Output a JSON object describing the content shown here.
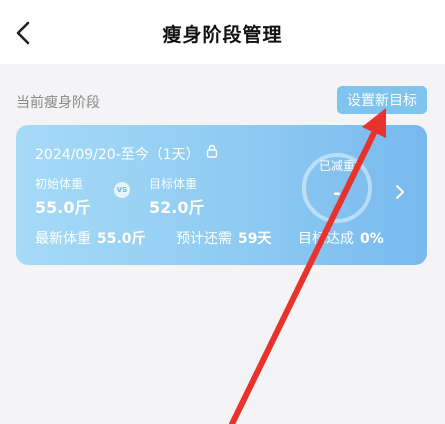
{
  "header": {
    "title": "瘦身阶段管理",
    "back_icon": "chevron-left-icon"
  },
  "section": {
    "label": "当前瘦身阶段",
    "set_goal_button": "设置新目标"
  },
  "stage_card": {
    "date_range": "2024/09/20-至今（1天）",
    "lock_icon": "lock-icon",
    "initial_weight_label": "初始体重",
    "initial_weight_value": "55.0斤",
    "vs_text": "VS",
    "target_weight_label": "目标体重",
    "target_weight_value": "52.0斤",
    "latest_weight_label": "最新体重",
    "latest_weight_value": "55.0斤",
    "remaining_label": "预计还需",
    "remaining_value": "59天",
    "goal_label": "目标达成",
    "goal_value": "0%",
    "ring_label": "已减重",
    "ring_value": "-",
    "chevron_icon": "chevron-right-icon"
  },
  "overlay": {
    "annotation": "red-arrow",
    "color": "#e8322c"
  },
  "colors": {
    "card_start": "#a6daf6",
    "card_end": "#78b9ee",
    "button": "#7fc4ee",
    "background": "#f4f4f6"
  }
}
